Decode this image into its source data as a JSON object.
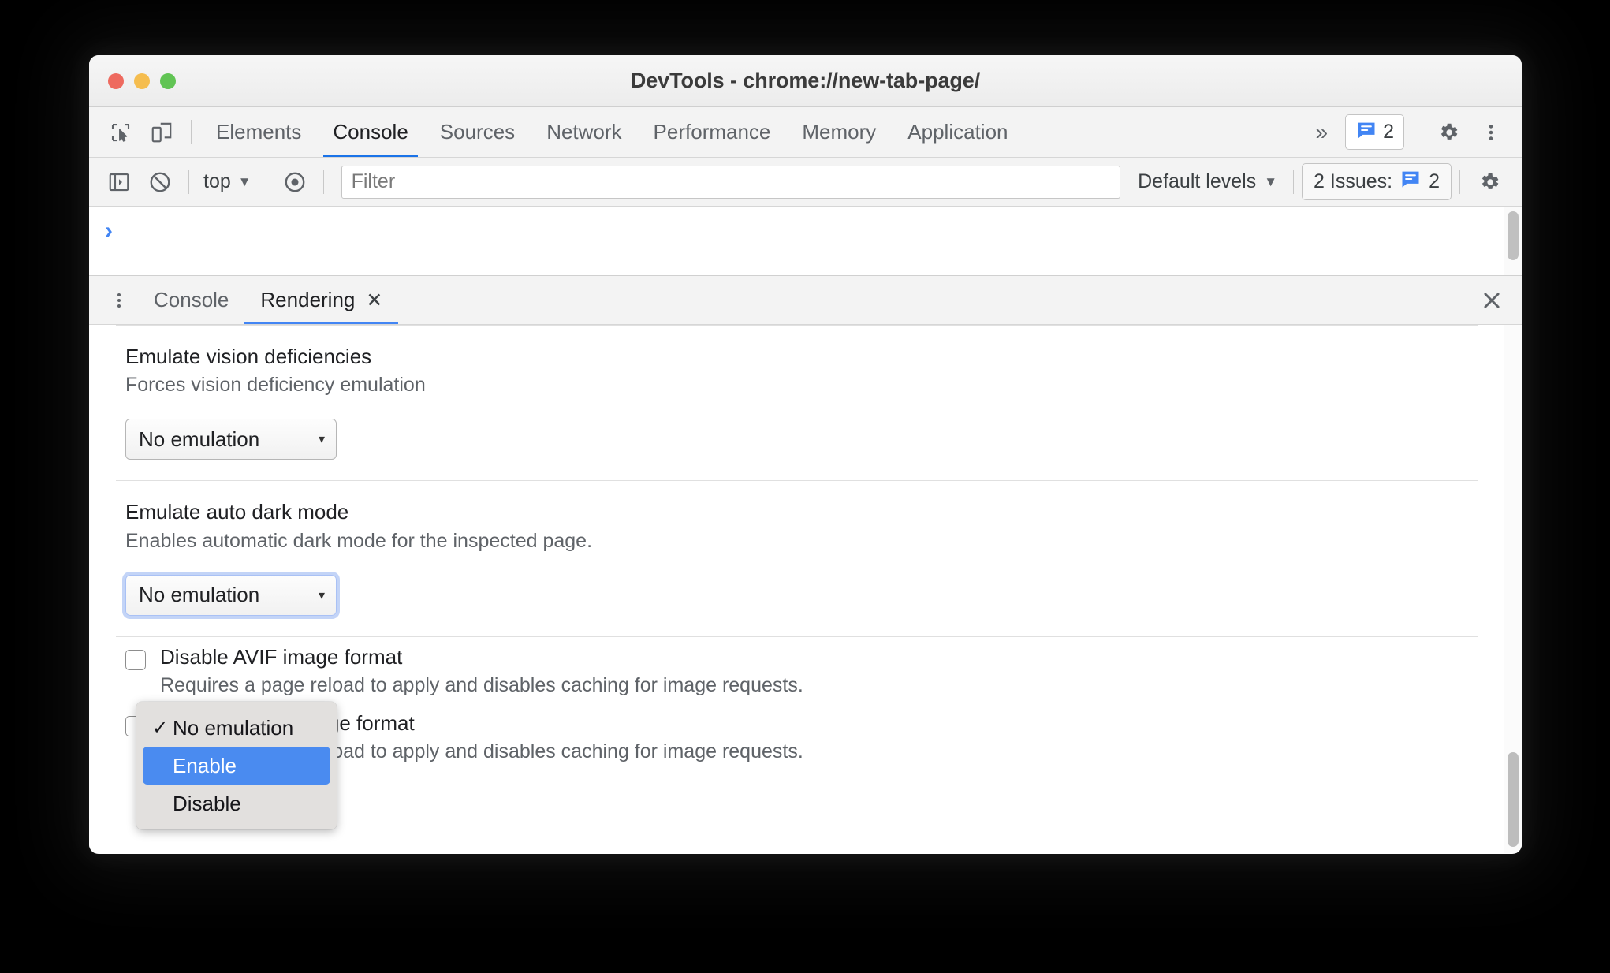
{
  "window": {
    "title": "DevTools - chrome://new-tab-page/",
    "traffic_lights": [
      "close",
      "minimize",
      "zoom"
    ],
    "colors": {
      "accent": "#1a73e8",
      "menu_highlight": "#4a8bf0",
      "prompt": "#4285f4"
    }
  },
  "main_tabbar": {
    "icons": [
      {
        "name": "inspect-element-icon",
        "label": "Inspect element"
      },
      {
        "name": "device-toolbar-icon",
        "label": "Toggle device toolbar"
      }
    ],
    "tabs": [
      {
        "label": "Elements",
        "active": false
      },
      {
        "label": "Console",
        "active": true
      },
      {
        "label": "Sources",
        "active": false
      },
      {
        "label": "Network",
        "active": false
      },
      {
        "label": "Performance",
        "active": false
      },
      {
        "label": "Memory",
        "active": false
      },
      {
        "label": "Application",
        "active": false
      }
    ],
    "more_tabs": "»",
    "issues_count": "2",
    "settings_label": "Settings",
    "more_label": "Customize and control DevTools"
  },
  "console_toolbar": {
    "sidebar_toggle": "Show console sidebar",
    "clear_console": "Clear console",
    "context": "top",
    "context_caret": "▼",
    "live_expression": "Create live expression",
    "filter_placeholder": "Filter",
    "filter_value": "",
    "levels_label": "Default levels",
    "levels_caret": "▼",
    "issues_label": "2 Issues:",
    "issues_count": "2",
    "settings_label": "Console settings"
  },
  "console": {
    "prompt": "›"
  },
  "drawer": {
    "more_label": "More tools",
    "tabs": [
      {
        "label": "Console",
        "active": false,
        "closable": false
      },
      {
        "label": "Rendering",
        "active": true,
        "closable": true,
        "close_glyph": "✕"
      }
    ],
    "close_glyph": "✕"
  },
  "rendering": {
    "sections": [
      {
        "title": "Emulate vision deficiencies",
        "desc": "Forces vision deficiency emulation",
        "select_value": "No emulation",
        "select_arrow": "▾",
        "focused": false
      },
      {
        "title": "Emulate auto dark mode",
        "desc": "Enables automatic dark mode for the inspected page.",
        "select_value": "No emulation",
        "select_arrow": "▾",
        "focused": true
      }
    ],
    "checkboxes": [
      {
        "title": "Disable AVIF image format",
        "desc": "Requires a page reload to apply and disables caching for image requests.",
        "checked": false
      },
      {
        "title": "Disable WebP image format",
        "desc": "Requires a page reload to apply and disables caching for image requests.",
        "checked": false
      }
    ]
  },
  "dropdown_menu": {
    "open": true,
    "items": [
      {
        "label": "No emulation",
        "checked": true,
        "highlighted": false,
        "check_glyph": "✓"
      },
      {
        "label": "Enable",
        "checked": false,
        "highlighted": true,
        "check_glyph": ""
      },
      {
        "label": "Disable",
        "checked": false,
        "highlighted": false,
        "check_glyph": ""
      }
    ]
  }
}
